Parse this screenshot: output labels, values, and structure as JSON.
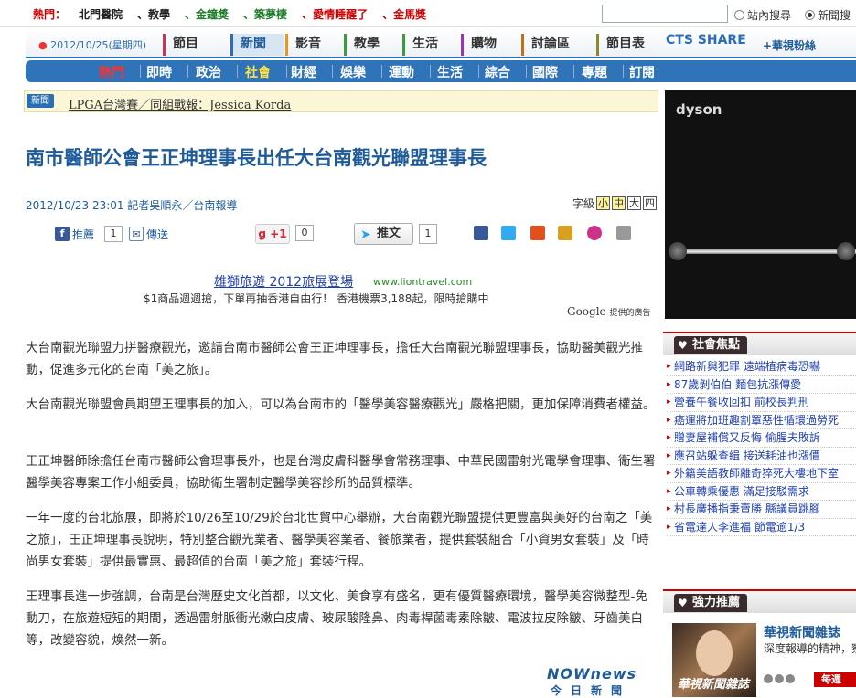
{
  "hotbar": {
    "label": "熱門：",
    "items": [
      {
        "text": "北門醫院",
        "color": "#222222"
      },
      {
        "text": "、教學",
        "color": "#222222"
      },
      {
        "text": "、金鐘獎",
        "color": "#1f7a2a"
      },
      {
        "text": "、築夢棲",
        "color": "#1f7a2a"
      },
      {
        "text": "、愛情睡醒了",
        "color": "#cc0000"
      },
      {
        "text": "、金馬獎",
        "color": "#cc0000"
      }
    ],
    "search_placeholder": "",
    "radio_site": "站內搜尋",
    "radio_news": "新聞搜"
  },
  "mainnav": {
    "date": "2012/10/25(星期四)",
    "tabs": [
      {
        "label": "節目",
        "color": "#cc3355"
      },
      {
        "label": "新聞",
        "color": "#2a6fb5",
        "active": true
      },
      {
        "label": "影音",
        "color": "#e39b1f"
      },
      {
        "label": "教學",
        "color": "#3a9c3a"
      },
      {
        "label": "生活",
        "color": "#3a9c3a"
      },
      {
        "label": "購物",
        "color": "#9a33b5"
      },
      {
        "label": "討論區",
        "color": "#c46e1a"
      },
      {
        "label": "節目表",
        "color": "#8a8a2a"
      }
    ],
    "cts": "CTS SHARE",
    "link": "+華視粉絲"
  },
  "subnav": {
    "items": [
      {
        "label": "熱門",
        "kind": "hot"
      },
      {
        "label": "即時",
        "kind": ""
      },
      {
        "label": "政治",
        "kind": ""
      },
      {
        "label": "社會",
        "kind": "active"
      },
      {
        "label": "財經",
        "kind": ""
      },
      {
        "label": "娛樂",
        "kind": ""
      },
      {
        "label": "運動",
        "kind": ""
      },
      {
        "label": "生活",
        "kind": ""
      },
      {
        "label": "綜合",
        "kind": ""
      },
      {
        "label": "國際",
        "kind": ""
      },
      {
        "label": "專題",
        "kind": ""
      },
      {
        "label": "訂閱",
        "kind": ""
      }
    ]
  },
  "ticker": {
    "tag": "新聞",
    "text": "LPGA台灣賽／同組戰報：Jessica Korda"
  },
  "article": {
    "headline": "南市醫師公會王正坤理事長出任大台南觀光聯盟理事長",
    "meta": "2012/10/23 23:01 記者吳順永／台南報導",
    "fontsize_label": "字級",
    "fontsizes": [
      "小",
      "中",
      "大",
      "四"
    ],
    "share": {
      "push_label": "推薦",
      "push_count": "1",
      "send_label": "傳送",
      "gplus_label": "+1",
      "gplus_count": "0",
      "tweet_label": "推文",
      "tweet_count": "1"
    },
    "ad": {
      "title": "雄獅旅遊 2012旅展登場",
      "url": "www.liontravel.com",
      "desc": "$1商品週週搶，下單再抽香港自由行！ 香港機票3,188起，限時搶購中",
      "google": "Google",
      "google_small": "提供的廣告"
    },
    "paragraphs": [
      "大台南觀光聯盟力拼醫療觀光，邀請台南市醫師公會王正坤理事長，擔任大台南觀光聯盟理事長，協助醫美觀光推動，促進多元化的台南「美之旅」。",
      "大台南觀光聯盟會員期望王理事長的加入，可以為台南市的「醫學美容醫療觀光」嚴格把關，更加保障消費者權益。",
      "王正坤醫師除擔任台南市醫師公會理事長外，也是台灣皮膚科醫學會常務理事、中華民國雷射光電學會理事、衛生署醫學美容專案工作小組委員，協助衛生署制定醫學美容診所的品質標準。",
      "一年一度的台北旅展，即將於10/26至10/29於台北世貿中心舉辦，大台南觀光聯盟提供更豐富與美好的台南之「美之旅」，王正坤理事長說明，特別整合觀光業者、醫學美容業者、餐旅業者，提供套裝組合「小資男女套裝」及「時尚男女套裝」提供最實惠、最超值的台南「美之旅」套裝行程。",
      "王理事長進一步強調，台南是台灣歷史文化首都，以文化、美食享有盛名，更有優質醫療環境，醫學美容微整型-免動刀，在旅遊短短的期間，透過雷射脈衝光嫩白皮膚、玻尿酸隆鼻、肉毒桿菌毒素除皺、電波拉皮除皺、牙齒美白等，改變容貌，煥然一新。"
    ],
    "logo_top": "NOWnews",
    "logo_bottom": "今日新聞"
  },
  "sidebar": {
    "dyson": "dyson",
    "focus_title": "社會焦點",
    "focus_items": [
      "網路新與犯罪 遠端植病毒恐嚇",
      "87歲剝伯伯 麵包抗漲傳愛",
      "營養午餐收回扣 前校長判刑",
      "癌運將加班趣割罩惡性循環過勞死",
      "贈妻屋補償又反悔 偷腥夫敗訴",
      "應召站躲查緝 接送耗油也漲價",
      "外籍美語教師離奇猝死大樓地下室",
      "公車轉乘優惠 滿足接駁需求",
      "村長廣播指秉賣勝 縣議員跳腳",
      "省電達人李進福 節電逾1/3"
    ],
    "push_title": "強力推薦",
    "mag_title": "華視新聞雜誌",
    "mag_desc": "深度報導的精神，察，為觀眾解讀真",
    "mag_more": "每週"
  }
}
